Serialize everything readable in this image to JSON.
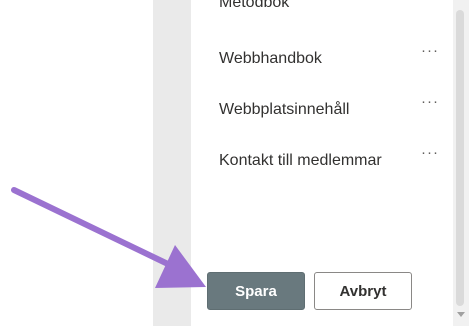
{
  "nav": {
    "items": [
      {
        "label": "Metodbok",
        "more": ""
      },
      {
        "label": "Webbhandbok",
        "more": "···"
      },
      {
        "label": "Webbplatsinnehåll",
        "more": "···"
      },
      {
        "label": "Kontakt till medlemmar",
        "more": "···"
      }
    ]
  },
  "actions": {
    "save_label": "Spara",
    "cancel_label": "Avbryt"
  },
  "annotation": {
    "arrow_color": "#9b72d0"
  },
  "colors": {
    "save_button": "#69797e",
    "side_strip": "#eaeaea"
  }
}
